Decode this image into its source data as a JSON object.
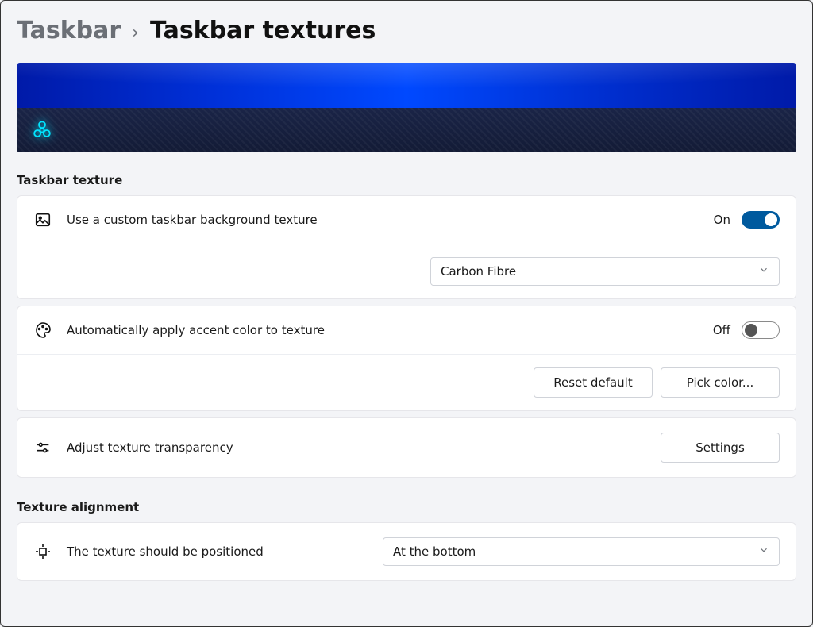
{
  "breadcrumb": {
    "parent": "Taskbar",
    "current": "Taskbar textures"
  },
  "sections": {
    "texture": {
      "title": "Taskbar texture",
      "row_custom": {
        "label": "Use a custom taskbar background texture",
        "state_text": "On"
      },
      "texture_select": {
        "value": "Carbon Fibre"
      },
      "row_accent": {
        "label": "Automatically apply accent color to texture",
        "state_text": "Off",
        "reset_btn": "Reset default",
        "pick_btn": "Pick color..."
      },
      "row_transparency": {
        "label": "Adjust texture transparency",
        "settings_btn": "Settings"
      }
    },
    "alignment": {
      "title": "Texture alignment",
      "row_position": {
        "label": "The texture should be positioned",
        "value": "At the bottom"
      }
    }
  }
}
